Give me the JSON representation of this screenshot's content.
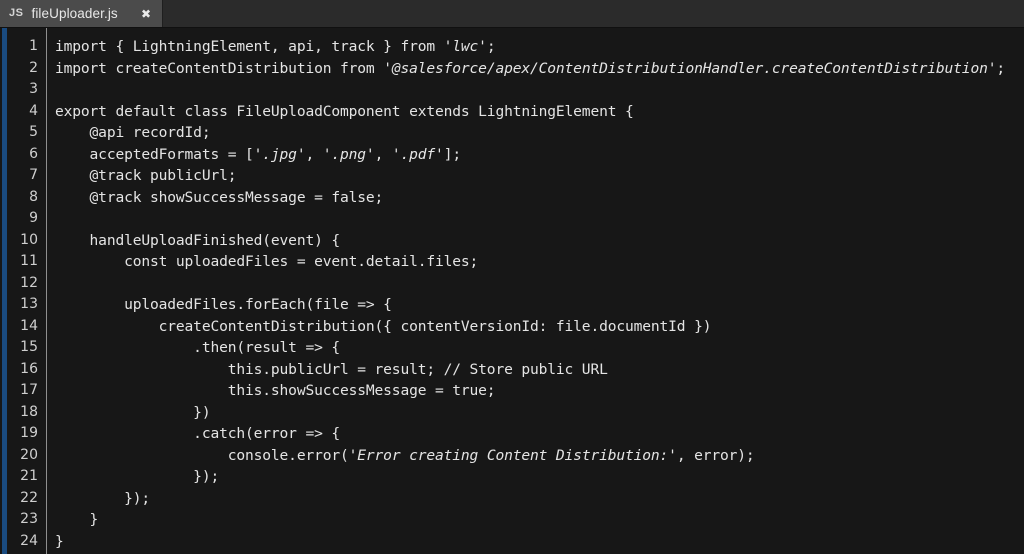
{
  "window": {
    "background_color": "#171717",
    "tabbar_color": "#2b2b2b",
    "accent_color": "#1a4b80",
    "text_color": "#e4e4e4",
    "gutter_text_color": "#cfcfcf"
  },
  "tabbar": {
    "active_tab": {
      "file_icon_label": "JS",
      "title": "fileUploader.js",
      "close_label": "✖"
    }
  },
  "editor": {
    "language": "javascript",
    "line_numbers": [
      "1",
      "2",
      "3",
      "4",
      "5",
      "6",
      "7",
      "8",
      "9",
      "10",
      "11",
      "12",
      "13",
      "14",
      "15",
      "16",
      "17",
      "18",
      "19",
      "20",
      "21",
      "22",
      "23",
      "24"
    ],
    "lines": [
      [
        {
          "t": "import { LightningElement, api, track } from ",
          "s": false
        },
        {
          "t": "'lwc'",
          "s": true
        },
        {
          "t": ";",
          "s": false
        }
      ],
      [
        {
          "t": "import createContentDistribution from ",
          "s": false
        },
        {
          "t": "'@salesforce/apex/ContentDistributionHandler.createContentDistribution'",
          "s": true
        },
        {
          "t": ";",
          "s": false
        }
      ],
      [
        {
          "t": "",
          "s": false
        }
      ],
      [
        {
          "t": "export default class FileUploadComponent extends LightningElement {",
          "s": false
        }
      ],
      [
        {
          "t": "    @api recordId;",
          "s": false
        }
      ],
      [
        {
          "t": "    acceptedFormats = [",
          "s": false
        },
        {
          "t": "'.jpg'",
          "s": true
        },
        {
          "t": ", ",
          "s": false
        },
        {
          "t": "'.png'",
          "s": true
        },
        {
          "t": ", ",
          "s": false
        },
        {
          "t": "'.pdf'",
          "s": true
        },
        {
          "t": "];",
          "s": false
        }
      ],
      [
        {
          "t": "    @track publicUrl;",
          "s": false
        }
      ],
      [
        {
          "t": "    @track showSuccessMessage = false;",
          "s": false
        }
      ],
      [
        {
          "t": "",
          "s": false
        }
      ],
      [
        {
          "t": "    handleUploadFinished(event) {",
          "s": false
        }
      ],
      [
        {
          "t": "        const uploadedFiles = event.detail.files;",
          "s": false
        }
      ],
      [
        {
          "t": "",
          "s": false
        }
      ],
      [
        {
          "t": "        uploadedFiles.forEach(file => {",
          "s": false
        }
      ],
      [
        {
          "t": "            createContentDistribution({ contentVersionId: file.documentId })",
          "s": false
        }
      ],
      [
        {
          "t": "                .then(result => {",
          "s": false
        }
      ],
      [
        {
          "t": "                    this.publicUrl = result; // Store public URL",
          "s": false
        }
      ],
      [
        {
          "t": "                    this.showSuccessMessage = true;",
          "s": false
        }
      ],
      [
        {
          "t": "                })",
          "s": false
        }
      ],
      [
        {
          "t": "                .catch(error => {",
          "s": false
        }
      ],
      [
        {
          "t": "                    console.error(",
          "s": false
        },
        {
          "t": "'Error creating Content Distribution:'",
          "s": true
        },
        {
          "t": ", error);",
          "s": false
        }
      ],
      [
        {
          "t": "                });",
          "s": false
        }
      ],
      [
        {
          "t": "        });",
          "s": false
        }
      ],
      [
        {
          "t": "    }",
          "s": false
        }
      ],
      [
        {
          "t": "}",
          "s": false
        }
      ]
    ]
  }
}
